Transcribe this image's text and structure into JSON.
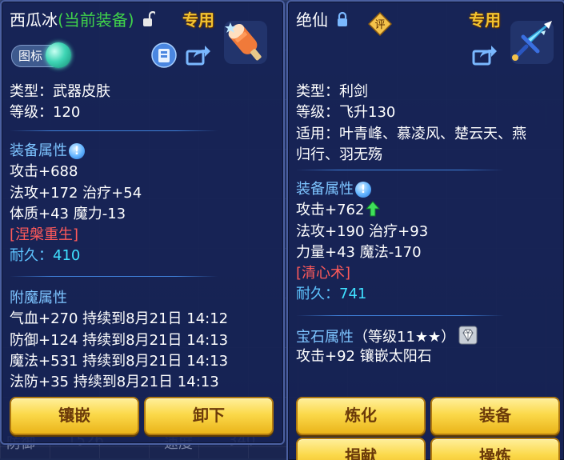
{
  "left_panel": {
    "item_name": "西瓜冰",
    "equip_tag": "(当前装备)",
    "special_label": "专用",
    "icon_toggle_label": "图标",
    "type_line": "类型：武器皮肤",
    "level_line": "等级：120",
    "attr_header": "装备属性",
    "attrs": [
      "攻击+688",
      "法攻+172 治疗+54",
      "体质+43 魔力-13"
    ],
    "skill": "[涅槃重生]",
    "durability_label": "耐久：",
    "durability_value": "410",
    "enchant_header": "附魔属性",
    "enchants": [
      "气血+270 持续到8月21日 14:12",
      "防御+124 持续到8月21日 14:13",
      "魔法+531 持续到8月21日 14:13",
      "法防+35 持续到8月21日 14:13"
    ],
    "buttons": [
      "镶嵌",
      "卸下"
    ]
  },
  "right_panel": {
    "item_name": "绝仙",
    "rating_badge": "评",
    "special_label": "专用",
    "type_line": "类型：利剑",
    "level_line": "等级：飞升130",
    "suit_line1": "适用：叶青峰、慕凌风、楚云天、燕",
    "suit_line2": "归行、羽无殇",
    "attr_header": "装备属性",
    "attrs": [
      "攻击+762",
      "法攻+190 治疗+93",
      "力量+43 魔法-170"
    ],
    "skill": "[清心术]",
    "durability_label": "耐久：",
    "durability_value": "741",
    "gem_header": "宝石属性",
    "gem_level": "（等级11★★）",
    "gem_effect": "攻击+92 镶嵌太阳石",
    "buttons": [
      "炼化",
      "装备",
      "捐献",
      "操炼"
    ]
  },
  "background_text": {
    "bottom_left": "防御",
    "bottom_value1": "1526",
    "bottom_label2": "速度",
    "bottom_value2": "340"
  },
  "colors": {
    "gold_title": "#f2c230",
    "equip_green": "#3fd24a",
    "section_blue": "#7dc4ff",
    "skill_red": "#ff5a5a",
    "durability_cyan": "#3fe0ff"
  },
  "icons": [
    "lock-open-icon",
    "lock-closed-icon",
    "rating-badge-icon",
    "popsicle-weapon-icon",
    "sword-weapon-icon",
    "fashion-icon",
    "share-icon",
    "info-icon",
    "arrow-up-icon",
    "gem-icon"
  ]
}
